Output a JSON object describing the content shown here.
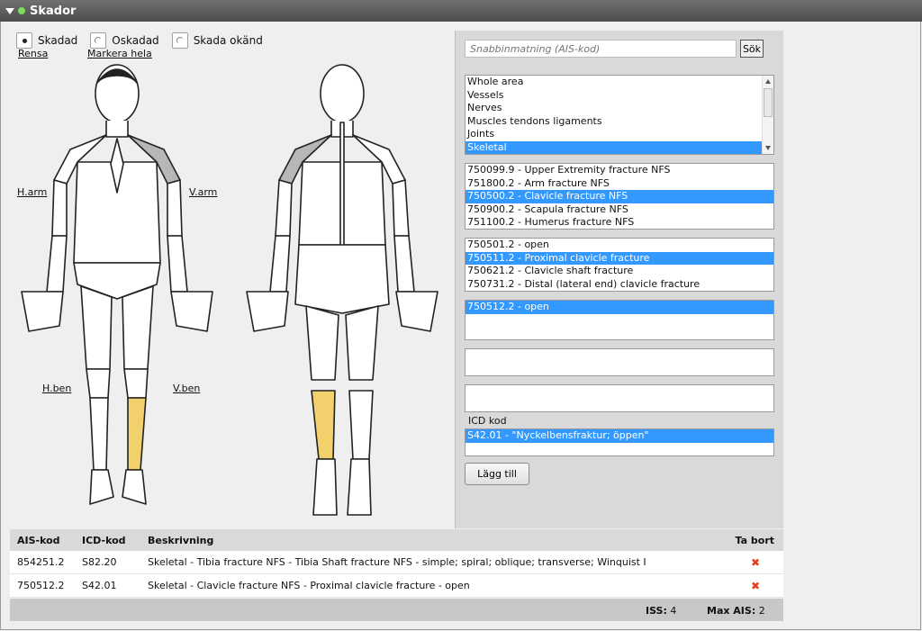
{
  "window": {
    "title": "Skador"
  },
  "radios": [
    {
      "label": "Skadad",
      "checked": true
    },
    {
      "label": "Oskadad",
      "checked": false
    },
    {
      "label": "Skada okänd",
      "checked": false
    }
  ],
  "links": {
    "clear": "Rensa",
    "mark_all": "Markera hela",
    "right_arm": "H.arm",
    "left_arm": "V.arm",
    "right_leg": "H.ben",
    "left_leg": "V.ben"
  },
  "colors": {
    "highlight_gray": "#b7b7b7",
    "highlight_yellow": "#f2d06b",
    "selection": "#3399ff",
    "delete": "#e53b1e"
  },
  "search": {
    "placeholder": "Snabbinmatning (AIS-kod)",
    "button": "Sök"
  },
  "lists": {
    "area": [
      "Whole area",
      "Vessels",
      "Nerves",
      "Muscles tendons ligaments",
      "Joints",
      "Skeletal"
    ],
    "area_selected": 5,
    "fracture": [
      "750099.9 - Upper Extremity fracture NFS",
      "751800.2 - Arm fracture NFS",
      "750500.2 - Clavicle fracture NFS",
      "750900.2 - Scapula fracture NFS",
      "751100.2 - Humerus fracture NFS"
    ],
    "fracture_selected": 2,
    "clavicle": [
      "750501.2 - open",
      "750511.2 - Proximal clavicle fracture",
      "750621.2 - Clavicle shaft fracture",
      "750731.2 - Distal (lateral end) clavicle fracture"
    ],
    "clavicle_selected": 1,
    "proximal": [
      "750512.2 - open"
    ],
    "proximal_selected": 0
  },
  "icd": {
    "label": "ICD kod",
    "items": [
      "S42.01 - \"Nyckelbensfraktur; öppen\""
    ]
  },
  "add_button": "Lägg till",
  "table": {
    "headers": {
      "ais": "AIS-kod",
      "icd": "ICD-kod",
      "desc": "Beskrivning",
      "remove": "Ta bort"
    },
    "rows": [
      {
        "ais": "854251.2",
        "icd": "S82.20",
        "desc": "Skeletal - Tibia fracture NFS - Tibia Shaft fracture NFS - simple; spiral; oblique; transverse; Winquist I",
        "remove": "✖"
      },
      {
        "ais": "750512.2",
        "icd": "S42.01",
        "desc": "Skeletal - Clavicle fracture NFS - Proximal clavicle fracture - open",
        "remove": "✖"
      }
    ]
  },
  "summary": {
    "iss_label": "ISS:",
    "iss_value": "4",
    "max_label": "Max AIS:",
    "max_value": "2"
  }
}
